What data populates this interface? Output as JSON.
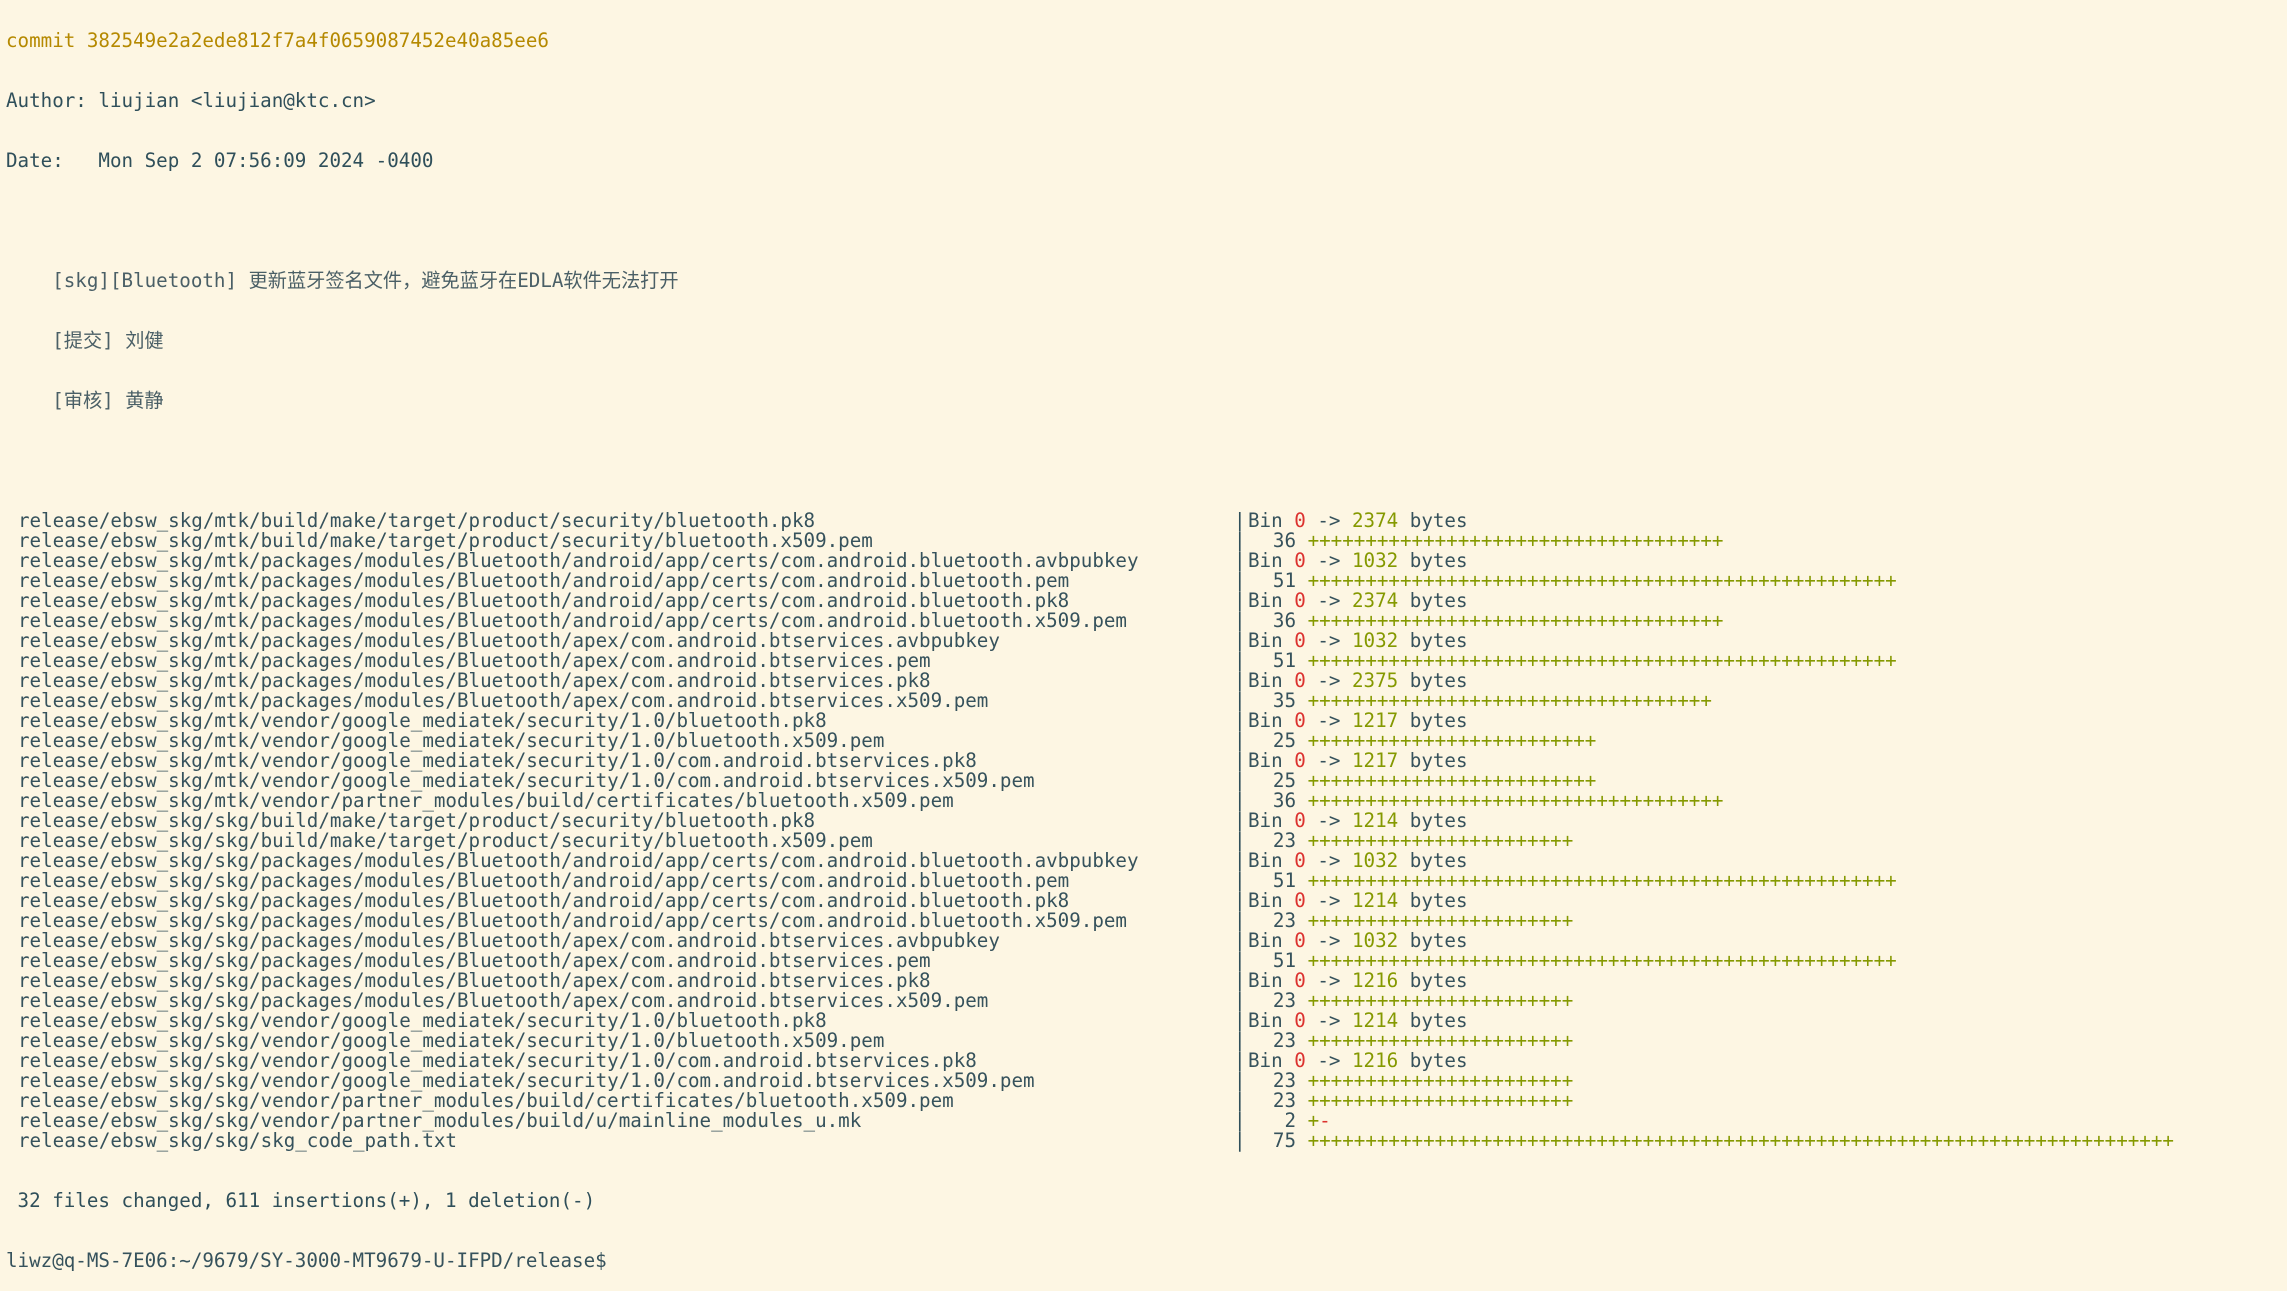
{
  "commit_line": "commit 382549e2a2ede812f7a4f0659087452e40a85ee6",
  "author_line": "Author: liujian <liujian@ktc.cn>",
  "date_line": "Date:   Mon Sep 2 07:56:09 2024 -0400",
  "message": [
    "    [skg][Bluetooth] 更新蓝牙签名文件，避免蓝牙在EDLA软件无法打开",
    "    [提交] 刘健",
    "    [审核] 黄静"
  ],
  "files": [
    {
      "path": "release/ebsw_skg/mtk/build/make/target/product/security/bluetooth.pk8",
      "bin": true,
      "old": "0",
      "new": "2374",
      "unit": "bytes"
    },
    {
      "path": "release/ebsw_skg/mtk/build/make/target/product/security/bluetooth.x509.pem",
      "bin": false,
      "count": "36",
      "plus": "++++++++++++++++++++++++++++++++++++",
      "minus": ""
    },
    {
      "path": "release/ebsw_skg/mtk/packages/modules/Bluetooth/android/app/certs/com.android.bluetooth.avbpubkey",
      "bin": true,
      "old": "0",
      "new": "1032",
      "unit": "bytes"
    },
    {
      "path": "release/ebsw_skg/mtk/packages/modules/Bluetooth/android/app/certs/com.android.bluetooth.pem",
      "bin": false,
      "count": "51",
      "plus": "+++++++++++++++++++++++++++++++++++++++++++++++++++",
      "minus": ""
    },
    {
      "path": "release/ebsw_skg/mtk/packages/modules/Bluetooth/android/app/certs/com.android.bluetooth.pk8",
      "bin": true,
      "old": "0",
      "new": "2374",
      "unit": "bytes"
    },
    {
      "path": "release/ebsw_skg/mtk/packages/modules/Bluetooth/android/app/certs/com.android.bluetooth.x509.pem",
      "bin": false,
      "count": "36",
      "plus": "++++++++++++++++++++++++++++++++++++",
      "minus": ""
    },
    {
      "path": "release/ebsw_skg/mtk/packages/modules/Bluetooth/apex/com.android.btservices.avbpubkey",
      "bin": true,
      "old": "0",
      "new": "1032",
      "unit": "bytes"
    },
    {
      "path": "release/ebsw_skg/mtk/packages/modules/Bluetooth/apex/com.android.btservices.pem",
      "bin": false,
      "count": "51",
      "plus": "+++++++++++++++++++++++++++++++++++++++++++++++++++",
      "minus": ""
    },
    {
      "path": "release/ebsw_skg/mtk/packages/modules/Bluetooth/apex/com.android.btservices.pk8",
      "bin": true,
      "old": "0",
      "new": "2375",
      "unit": "bytes"
    },
    {
      "path": "release/ebsw_skg/mtk/packages/modules/Bluetooth/apex/com.android.btservices.x509.pem",
      "bin": false,
      "count": "35",
      "plus": "+++++++++++++++++++++++++++++++++++",
      "minus": ""
    },
    {
      "path": "release/ebsw_skg/mtk/vendor/google_mediatek/security/1.0/bluetooth.pk8",
      "bin": true,
      "old": "0",
      "new": "1217",
      "unit": "bytes"
    },
    {
      "path": "release/ebsw_skg/mtk/vendor/google_mediatek/security/1.0/bluetooth.x509.pem",
      "bin": false,
      "count": "25",
      "plus": "+++++++++++++++++++++++++",
      "minus": ""
    },
    {
      "path": "release/ebsw_skg/mtk/vendor/google_mediatek/security/1.0/com.android.btservices.pk8",
      "bin": true,
      "old": "0",
      "new": "1217",
      "unit": "bytes"
    },
    {
      "path": "release/ebsw_skg/mtk/vendor/google_mediatek/security/1.0/com.android.btservices.x509.pem",
      "bin": false,
      "count": "25",
      "plus": "+++++++++++++++++++++++++",
      "minus": ""
    },
    {
      "path": "release/ebsw_skg/mtk/vendor/partner_modules/build/certificates/bluetooth.x509.pem",
      "bin": false,
      "count": "36",
      "plus": "++++++++++++++++++++++++++++++++++++",
      "minus": ""
    },
    {
      "path": "release/ebsw_skg/skg/build/make/target/product/security/bluetooth.pk8",
      "bin": true,
      "old": "0",
      "new": "1214",
      "unit": "bytes"
    },
    {
      "path": "release/ebsw_skg/skg/build/make/target/product/security/bluetooth.x509.pem",
      "bin": false,
      "count": "23",
      "plus": "+++++++++++++++++++++++",
      "minus": ""
    },
    {
      "path": "release/ebsw_skg/skg/packages/modules/Bluetooth/android/app/certs/com.android.bluetooth.avbpubkey",
      "bin": true,
      "old": "0",
      "new": "1032",
      "unit": "bytes"
    },
    {
      "path": "release/ebsw_skg/skg/packages/modules/Bluetooth/android/app/certs/com.android.bluetooth.pem",
      "bin": false,
      "count": "51",
      "plus": "+++++++++++++++++++++++++++++++++++++++++++++++++++",
      "minus": ""
    },
    {
      "path": "release/ebsw_skg/skg/packages/modules/Bluetooth/android/app/certs/com.android.bluetooth.pk8",
      "bin": true,
      "old": "0",
      "new": "1214",
      "unit": "bytes"
    },
    {
      "path": "release/ebsw_skg/skg/packages/modules/Bluetooth/android/app/certs/com.android.bluetooth.x509.pem",
      "bin": false,
      "count": "23",
      "plus": "+++++++++++++++++++++++",
      "minus": ""
    },
    {
      "path": "release/ebsw_skg/skg/packages/modules/Bluetooth/apex/com.android.btservices.avbpubkey",
      "bin": true,
      "old": "0",
      "new": "1032",
      "unit": "bytes"
    },
    {
      "path": "release/ebsw_skg/skg/packages/modules/Bluetooth/apex/com.android.btservices.pem",
      "bin": false,
      "count": "51",
      "plus": "+++++++++++++++++++++++++++++++++++++++++++++++++++",
      "minus": ""
    },
    {
      "path": "release/ebsw_skg/skg/packages/modules/Bluetooth/apex/com.android.btservices.pk8",
      "bin": true,
      "old": "0",
      "new": "1216",
      "unit": "bytes"
    },
    {
      "path": "release/ebsw_skg/skg/packages/modules/Bluetooth/apex/com.android.btservices.x509.pem",
      "bin": false,
      "count": "23",
      "plus": "+++++++++++++++++++++++",
      "minus": ""
    },
    {
      "path": "release/ebsw_skg/skg/vendor/google_mediatek/security/1.0/bluetooth.pk8",
      "bin": true,
      "old": "0",
      "new": "1214",
      "unit": "bytes"
    },
    {
      "path": "release/ebsw_skg/skg/vendor/google_mediatek/security/1.0/bluetooth.x509.pem",
      "bin": false,
      "count": "23",
      "plus": "+++++++++++++++++++++++",
      "minus": ""
    },
    {
      "path": "release/ebsw_skg/skg/vendor/google_mediatek/security/1.0/com.android.btservices.pk8",
      "bin": true,
      "old": "0",
      "new": "1216",
      "unit": "bytes"
    },
    {
      "path": "release/ebsw_skg/skg/vendor/google_mediatek/security/1.0/com.android.btservices.x509.pem",
      "bin": false,
      "count": "23",
      "plus": "+++++++++++++++++++++++",
      "minus": ""
    },
    {
      "path": "release/ebsw_skg/skg/vendor/partner_modules/build/certificates/bluetooth.x509.pem",
      "bin": false,
      "count": "23",
      "plus": "+++++++++++++++++++++++",
      "minus": ""
    },
    {
      "path": "release/ebsw_skg/skg/vendor/partner_modules/build/u/mainline_modules_u.mk",
      "bin": false,
      "count": "2",
      "plus": "+",
      "minus": "-"
    },
    {
      "path": "release/ebsw_skg/skg/skg_code_path.txt",
      "bin": false,
      "count": "75",
      "plus": "+++++++++++++++++++++++++++++++++++++++++++++++++++++++++++++++++++++++++++",
      "minus": ""
    }
  ],
  "summary": " 32 files changed, 611 insertions(+), 1 deletion(-)",
  "prompt": "liwz@q-MS-7E06:~/9679/SY-3000-MT9679-U-IFPD/release$",
  "colors": {
    "background": "#fdf6e3",
    "text": "#36525c",
    "commit": "#b58900",
    "added": "#859900",
    "removed": "#dc322f"
  }
}
